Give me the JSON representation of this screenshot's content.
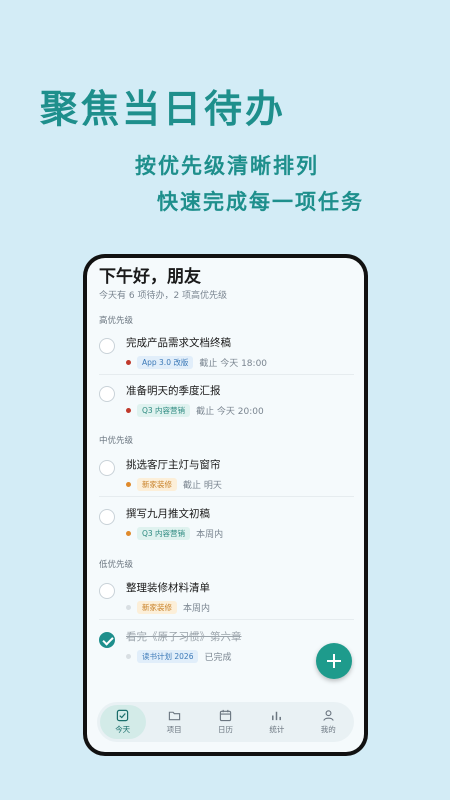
{
  "promo": {
    "headline": "聚焦当日待办",
    "line1": "按优先级清晰排列",
    "line2": "快速完成每一项任务"
  },
  "app": {
    "greeting": "下午好，朋友",
    "summary": "今天有 6 项待办，2 项高优先级",
    "sections": [
      {
        "title": "高优先级",
        "tasks": [
          {
            "title": "完成产品需求文档终稿",
            "tag": "App 3.0 改版",
            "due": "截止 今天 18:00",
            "dot_color": "#c0392b",
            "done": false
          },
          {
            "title": "准备明天的季度汇报",
            "tag": "Q3 内容营销",
            "due": "截止 今天 20:00",
            "dot_color": "#c0392b",
            "done": false
          }
        ]
      },
      {
        "title": "中优先级",
        "tasks": [
          {
            "title": "挑选客厅主灯与窗帘",
            "tag": "新家装修",
            "due": "截止 明天",
            "dot_color": "#e08a2b",
            "done": false
          },
          {
            "title": "撰写九月推文初稿",
            "tag": "Q3 内容营销",
            "due": "本周内",
            "dot_color": "#e08a2b",
            "done": false
          }
        ]
      },
      {
        "title": "低优先级",
        "tasks": [
          {
            "title": "整理装修材料清单",
            "tag": "新家装修",
            "due": "本周内",
            "dot_color": "#d9dfe3",
            "done": false
          },
          {
            "title": "看完《原子习惯》第六章",
            "tag": "读书计划 2026",
            "due": "已完成",
            "dot_color": "#d9dfe3",
            "done": true
          }
        ]
      }
    ],
    "tabs": [
      {
        "label": "今天",
        "icon": "checkbox-icon",
        "active": true
      },
      {
        "label": "项目",
        "icon": "folder-icon",
        "active": false
      },
      {
        "label": "日历",
        "icon": "calendar-icon",
        "active": false
      },
      {
        "label": "统计",
        "icon": "bar-chart-icon",
        "active": false
      },
      {
        "label": "我的",
        "icon": "person-icon",
        "active": false
      }
    ],
    "colors": {
      "accent": "#1e8f8c",
      "fab": "#1e9b8c"
    }
  }
}
